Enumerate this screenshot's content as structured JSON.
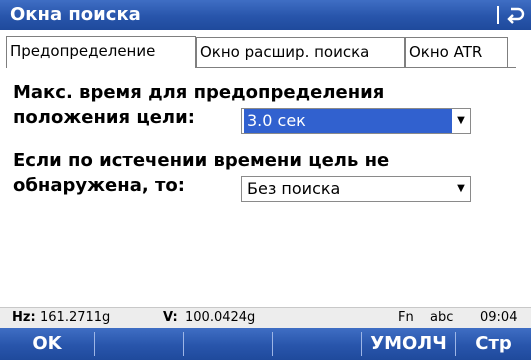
{
  "window": {
    "title": "Окна поиска",
    "back_icon": "return-arrow-icon"
  },
  "tabs": [
    {
      "label": "Предопределение",
      "active": true
    },
    {
      "label": "Окно расшир. поиска",
      "active": false
    },
    {
      "label": "Окно ATR",
      "active": false
    }
  ],
  "form": {
    "max_time_label_line1": "Макс. время для предопределения",
    "max_time_label_line2": "положения цели:",
    "max_time_value": "3.0 сек",
    "not_found_label_line1": "Если по истечении времени цель не",
    "not_found_label_line2": "обнаружена, то:",
    "not_found_value": "Без поиска"
  },
  "status": {
    "hz_label": "Hz:",
    "hz_value": "161.2711g",
    "v_label": "V:",
    "v_value": "100.0424g",
    "fn": "Fn",
    "input_mode": "abc",
    "time": "09:04"
  },
  "softkeys": {
    "f1": "OK",
    "f2": "",
    "f3": "",
    "f4": "",
    "f5": "УМОЛЧ",
    "f6": "Стр"
  },
  "colors": {
    "bar_blue": "#2855ab",
    "selection_blue": "#3161cf",
    "status_bg": "#ededed"
  }
}
